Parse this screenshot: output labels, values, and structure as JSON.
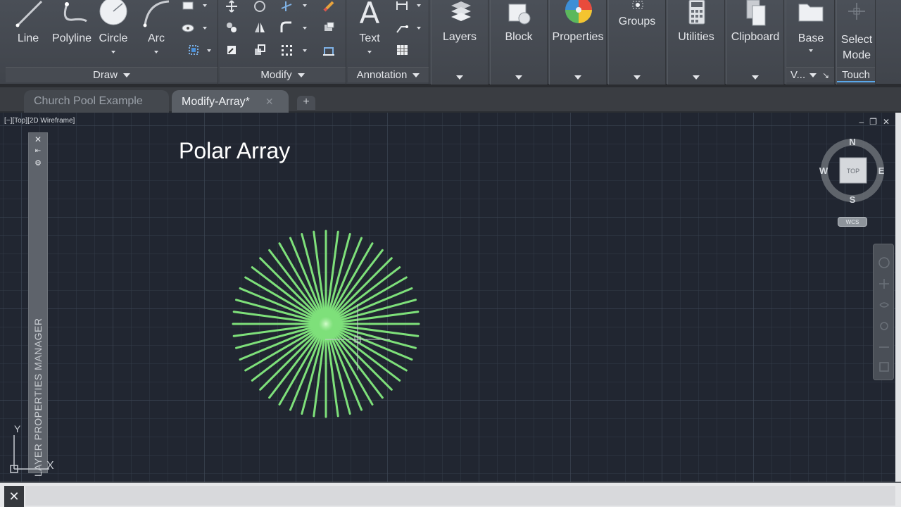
{
  "ribbon": {
    "draw": {
      "title": "Draw",
      "buttons": {
        "line": "Line",
        "polyline": "Polyline",
        "circle": "Circle",
        "arc": "Arc"
      }
    },
    "modify": {
      "title": "Modify"
    },
    "annotation": {
      "title": "Annotation",
      "text": "Text"
    },
    "layers": "Layers",
    "block": "Block",
    "properties": "Properties",
    "groups": "Groups",
    "utilities": "Utilities",
    "clipboard": "Clipboard",
    "view": {
      "base": "Base",
      "title": "V..."
    },
    "touch": {
      "select_mode": "Select Mode",
      "title": "Touch"
    }
  },
  "tabs": [
    {
      "label": "Church Pool Example",
      "active": false
    },
    {
      "label": "Modify-Array*",
      "active": true
    }
  ],
  "viewport": {
    "label": "[−][Top][2D Wireframe]",
    "drawing_title": "Polar Array",
    "palette_title": "LAYER PROPERTIES MANAGER",
    "ucs": {
      "y_axis": "Y",
      "x_axis": "X"
    },
    "viewcube": {
      "north": "N",
      "south": "S",
      "east": "E",
      "west": "W",
      "face": "TOP",
      "wcs": "WCS"
    },
    "polar_array": {
      "count": 48,
      "color": "#7ee07a"
    }
  },
  "colors": {
    "ribbon": "#43474e",
    "canvas": "#212631",
    "array_lines": "#7ee07a"
  }
}
